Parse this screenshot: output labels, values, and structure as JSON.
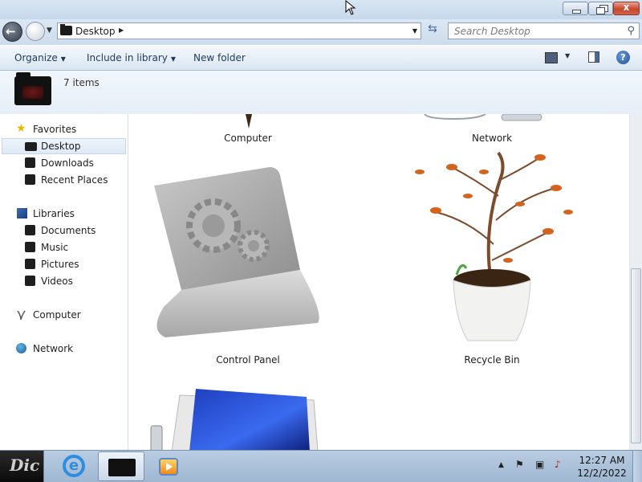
{
  "window": {
    "min_icon": "minimize-icon",
    "max_icon": "restore-icon",
    "close_icon": "close-icon",
    "close_glyph": "x"
  },
  "nav": {
    "address_crumb": "Desktop",
    "search_placeholder": "Search Desktop",
    "refresh_icon": "refresh-icon"
  },
  "toolbar": {
    "organize": "Organize",
    "include_in_library": "Include in library",
    "new_folder": "New folder",
    "help_glyph": "?"
  },
  "header": {
    "item_count": "7 items"
  },
  "sidebar": {
    "favorites": "Favorites",
    "desktop": "Desktop",
    "downloads": "Downloads",
    "recent_places": "Recent Places",
    "libraries": "Libraries",
    "documents": "Documents",
    "music": "Music",
    "pictures": "Pictures",
    "videos": "Videos",
    "computer": "Computer",
    "network": "Network"
  },
  "content": {
    "items": [
      {
        "label": "Computer",
        "icon": "computer-icon"
      },
      {
        "label": "Network",
        "icon": "network-icon"
      },
      {
        "label": "Control Panel",
        "icon": "control-panel-icon"
      },
      {
        "label": "Recycle Bin",
        "icon": "recycle-bin-icon"
      },
      {
        "label": "",
        "icon": "monitor-icon"
      }
    ]
  },
  "taskbar": {
    "start_label": "Dic",
    "apps": [
      "internet-explorer-icon",
      "explorer-folder-icon",
      "media-player-icon"
    ],
    "clock_time": "12:27 AM",
    "clock_date": "12/2/2022"
  },
  "colors": {
    "accent": "#1e395b",
    "selection": "#dfe9f5",
    "close_red": "#c9462c"
  }
}
